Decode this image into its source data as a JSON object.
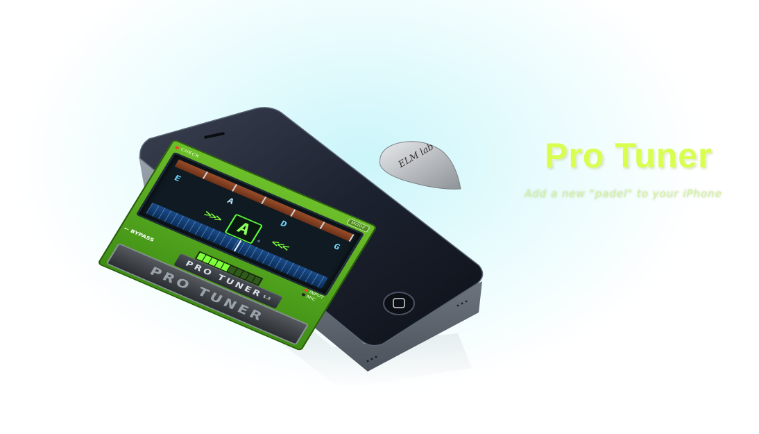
{
  "promo": {
    "title": "Pro Tuner",
    "subtitle": "Add a new \"padel\" to your iPhone"
  },
  "pick": {
    "label": "ELM lab"
  },
  "app": {
    "check_label": "CHECK",
    "mode_label": "MODE",
    "strings": [
      "E",
      "A",
      "D",
      "G"
    ],
    "active_string_index": 1,
    "note": "A",
    "note_octave": "4",
    "arrows_left": ">>>",
    "arrows_right": "<<<",
    "input_label": "INPUT",
    "mic_label": "MIC",
    "bypass_label": "BYPASS",
    "brand_plate": "PRO TUNER",
    "version": "1.2",
    "pedal_label": "PRO TUNER",
    "level_fraction": 0.45
  },
  "colors": {
    "accent_green": "#6dbf2a",
    "title_yellow": "#d8ff50",
    "display_cyan": "#6fd8ff",
    "note_green": "#8dff5a"
  }
}
